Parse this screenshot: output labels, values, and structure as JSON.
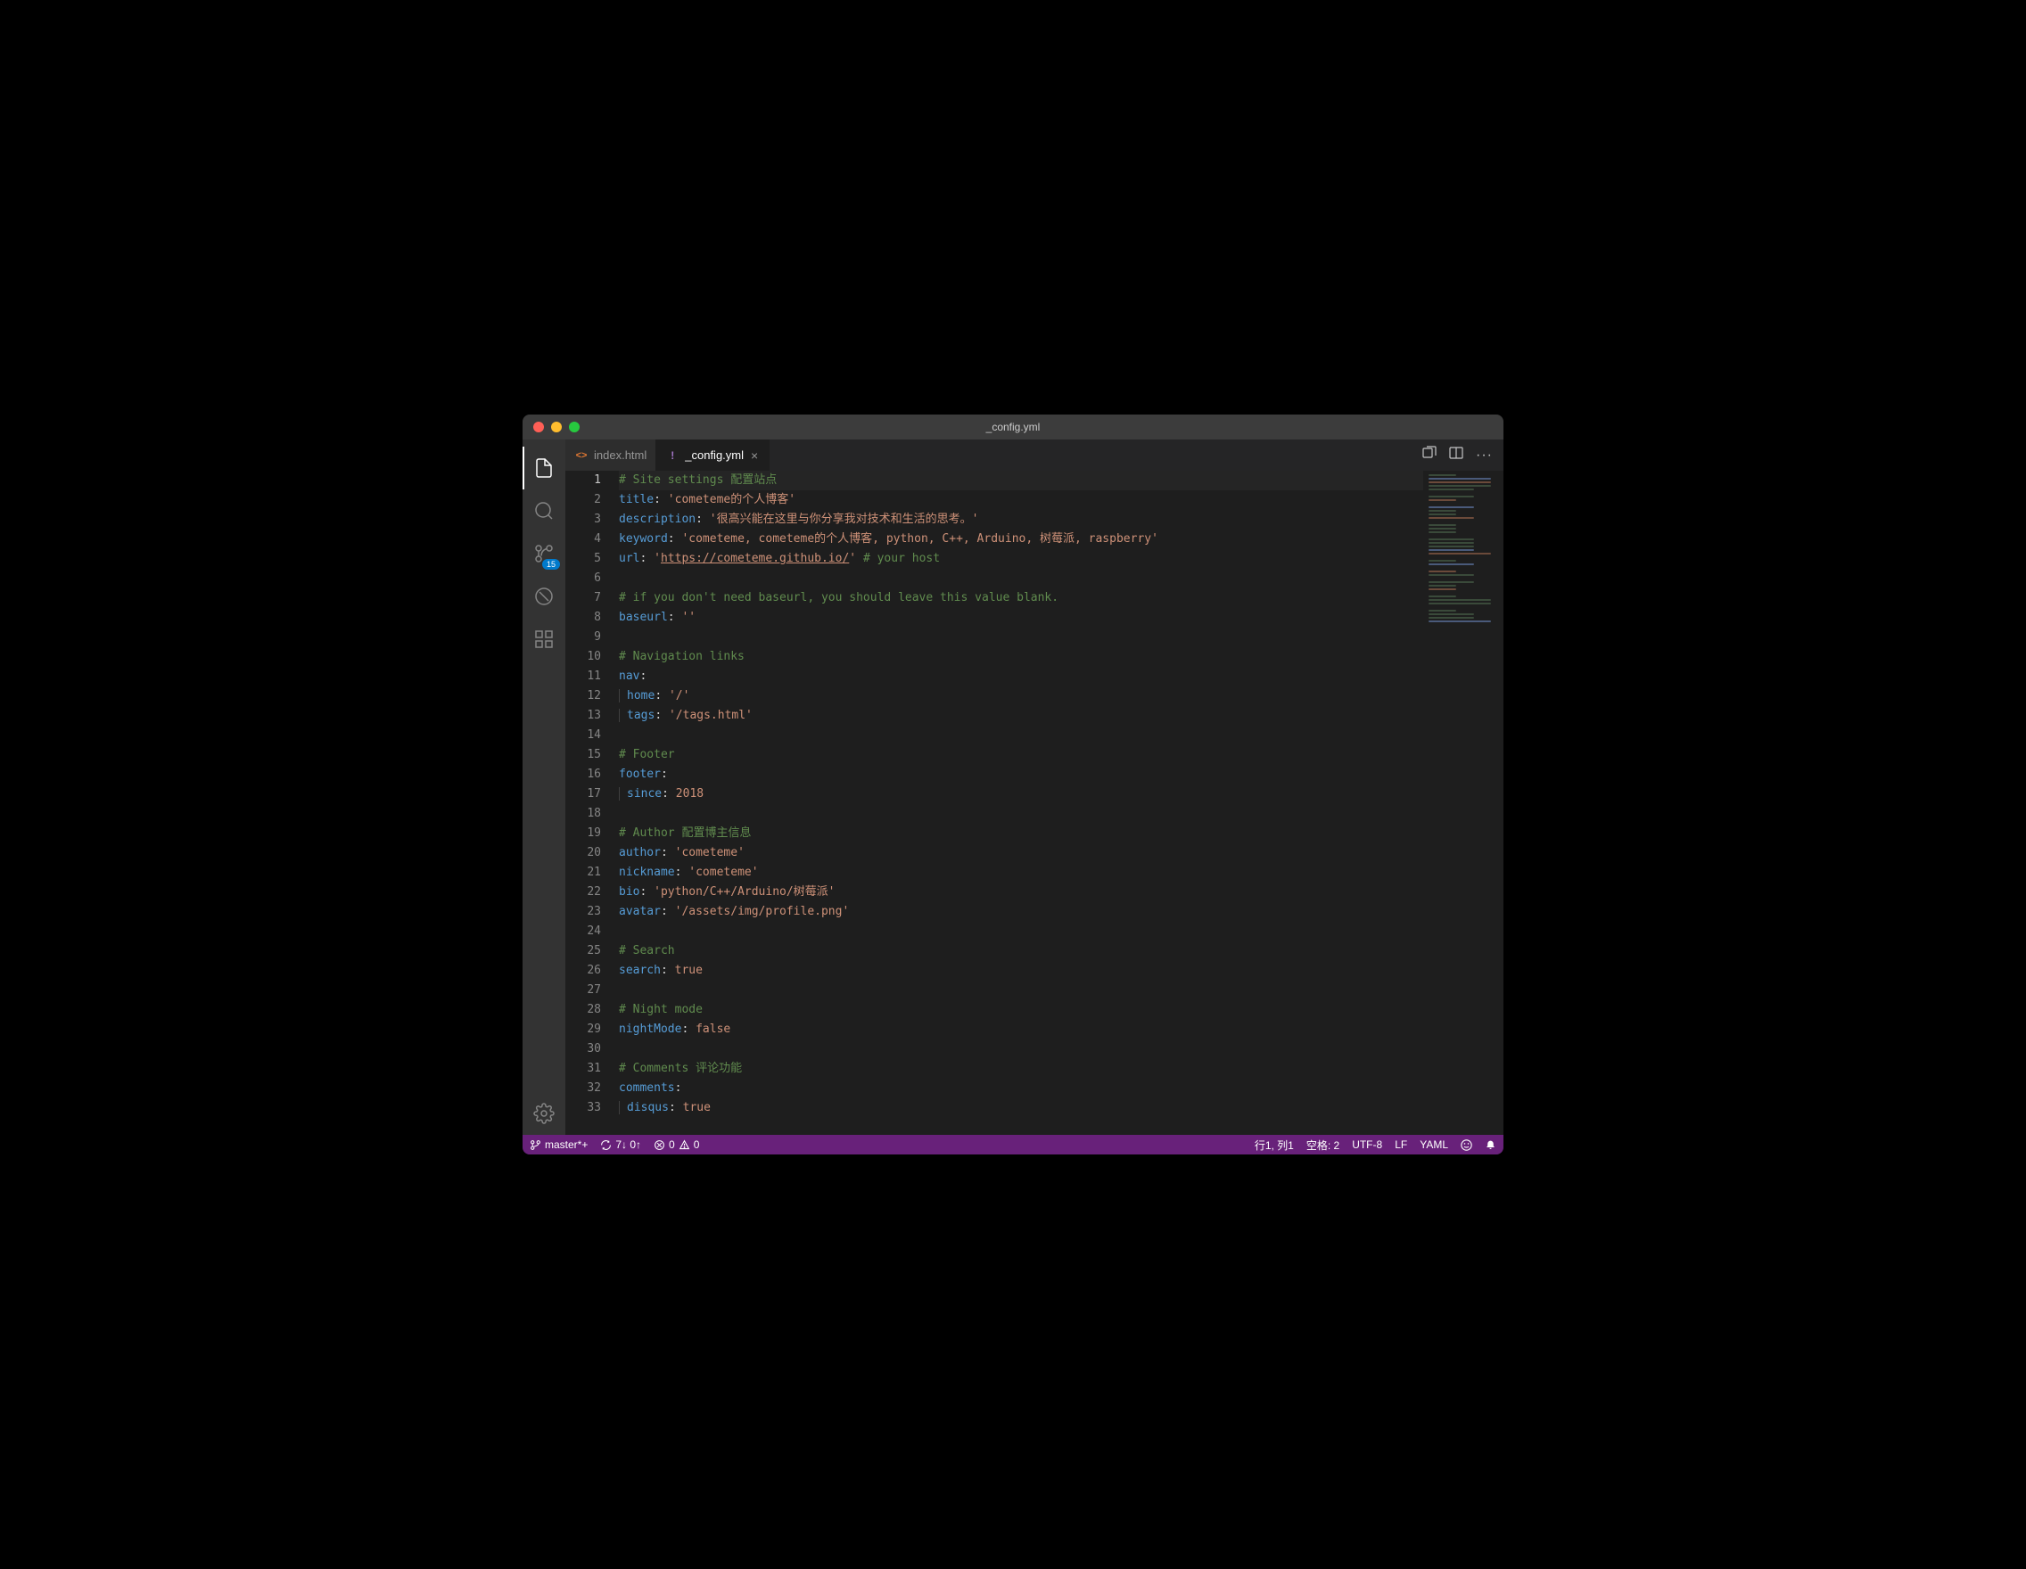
{
  "window": {
    "title": "_config.yml"
  },
  "tabs": [
    {
      "label": "index.html",
      "icon": "<>"
    },
    {
      "label": "_config.yml",
      "icon": "!",
      "active": true,
      "dirty": false
    }
  ],
  "scm_badge": "15",
  "lines": [
    {
      "n": 1,
      "tokens": [
        [
          "comment",
          "# Site settings 配置站点"
        ]
      ]
    },
    {
      "n": 2,
      "tokens": [
        [
          "key",
          "title"
        ],
        [
          "punct",
          ": "
        ],
        [
          "string",
          "'cometeme的个人博客'"
        ]
      ]
    },
    {
      "n": 3,
      "tokens": [
        [
          "key",
          "description"
        ],
        [
          "punct",
          ": "
        ],
        [
          "string",
          "'很高兴能在这里与你分享我对技术和生活的思考。'"
        ]
      ]
    },
    {
      "n": 4,
      "tokens": [
        [
          "key",
          "keyword"
        ],
        [
          "punct",
          ": "
        ],
        [
          "string",
          "'cometeme, cometeme的个人博客, python, C++, Arduino, 树莓派, raspberry'"
        ]
      ]
    },
    {
      "n": 5,
      "tokens": [
        [
          "key",
          "url"
        ],
        [
          "punct",
          ": "
        ],
        [
          "string",
          "'"
        ],
        [
          "link",
          "https://cometeme.github.io/"
        ],
        [
          "string",
          "'"
        ],
        [
          "punct",
          " "
        ],
        [
          "comment",
          "# your host"
        ]
      ]
    },
    {
      "n": 6,
      "tokens": []
    },
    {
      "n": 7,
      "tokens": [
        [
          "comment",
          "# if you don't need baseurl, you should leave this value blank."
        ]
      ]
    },
    {
      "n": 8,
      "tokens": [
        [
          "key",
          "baseurl"
        ],
        [
          "punct",
          ": "
        ],
        [
          "string",
          "''"
        ]
      ]
    },
    {
      "n": 9,
      "tokens": []
    },
    {
      "n": 10,
      "tokens": [
        [
          "comment",
          "# Navigation links"
        ]
      ]
    },
    {
      "n": 11,
      "tokens": [
        [
          "key",
          "nav"
        ],
        [
          "punct",
          ":"
        ]
      ]
    },
    {
      "n": 12,
      "indent": 1,
      "tokens": [
        [
          "key",
          "home"
        ],
        [
          "punct",
          ": "
        ],
        [
          "string",
          "'/'"
        ]
      ]
    },
    {
      "n": 13,
      "indent": 1,
      "tokens": [
        [
          "key",
          "tags"
        ],
        [
          "punct",
          ": "
        ],
        [
          "string",
          "'/tags.html'"
        ]
      ]
    },
    {
      "n": 14,
      "tokens": []
    },
    {
      "n": 15,
      "tokens": [
        [
          "comment",
          "# Footer"
        ]
      ]
    },
    {
      "n": 16,
      "tokens": [
        [
          "key",
          "footer"
        ],
        [
          "punct",
          ":"
        ]
      ]
    },
    {
      "n": 17,
      "indent": 1,
      "tokens": [
        [
          "key",
          "since"
        ],
        [
          "punct",
          ": "
        ],
        [
          "string",
          "2018"
        ]
      ]
    },
    {
      "n": 18,
      "tokens": []
    },
    {
      "n": 19,
      "tokens": [
        [
          "comment",
          "# Author 配置博主信息"
        ]
      ]
    },
    {
      "n": 20,
      "tokens": [
        [
          "key",
          "author"
        ],
        [
          "punct",
          ": "
        ],
        [
          "string",
          "'cometeme'"
        ]
      ]
    },
    {
      "n": 21,
      "tokens": [
        [
          "key",
          "nickname"
        ],
        [
          "punct",
          ": "
        ],
        [
          "string",
          "'cometeme'"
        ]
      ]
    },
    {
      "n": 22,
      "tokens": [
        [
          "key",
          "bio"
        ],
        [
          "punct",
          ": "
        ],
        [
          "string",
          "'python/C++/Arduino/树莓派'"
        ]
      ]
    },
    {
      "n": 23,
      "tokens": [
        [
          "key",
          "avatar"
        ],
        [
          "punct",
          ": "
        ],
        [
          "string",
          "'/assets/img/profile.png'"
        ]
      ]
    },
    {
      "n": 24,
      "tokens": []
    },
    {
      "n": 25,
      "tokens": [
        [
          "comment",
          "# Search"
        ]
      ]
    },
    {
      "n": 26,
      "tokens": [
        [
          "key",
          "search"
        ],
        [
          "punct",
          ": "
        ],
        [
          "string",
          "true"
        ]
      ]
    },
    {
      "n": 27,
      "tokens": []
    },
    {
      "n": 28,
      "tokens": [
        [
          "comment",
          "# Night mode"
        ]
      ]
    },
    {
      "n": 29,
      "tokens": [
        [
          "key",
          "nightMode"
        ],
        [
          "punct",
          ": "
        ],
        [
          "string",
          "false"
        ]
      ]
    },
    {
      "n": 30,
      "tokens": []
    },
    {
      "n": 31,
      "tokens": [
        [
          "comment",
          "# Comments 评论功能"
        ]
      ]
    },
    {
      "n": 32,
      "tokens": [
        [
          "key",
          "comments"
        ],
        [
          "punct",
          ":"
        ]
      ]
    },
    {
      "n": 33,
      "indent": 1,
      "tokens": [
        [
          "key",
          "disqus"
        ],
        [
          "punct",
          ": "
        ],
        [
          "string",
          "true"
        ]
      ]
    }
  ],
  "statusbar": {
    "branch": "master*+",
    "sync": "7↓ 0↑",
    "errors": "0",
    "warnings": "0",
    "position": "行1, 列1",
    "spaces": "空格: 2",
    "encoding": "UTF-8",
    "eol": "LF",
    "language": "YAML"
  }
}
